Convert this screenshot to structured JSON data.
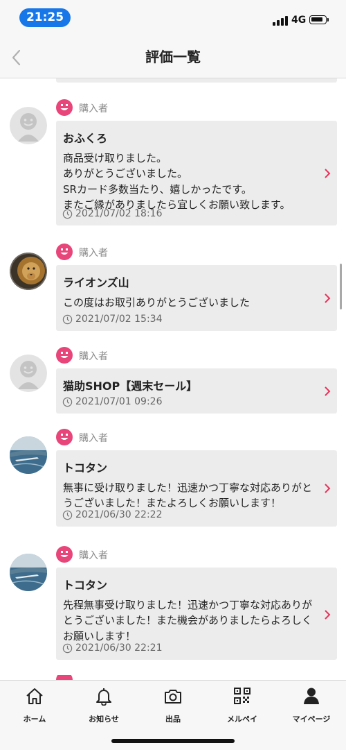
{
  "status_bar": {
    "time": "21:25",
    "network": "4G"
  },
  "header": {
    "title": "評価一覧"
  },
  "colors": {
    "accent_red": "#e8325a",
    "badge_pink": "#e8457a",
    "time_blue": "#1877e8",
    "card_bg": "#ececec"
  },
  "reviews": [
    {
      "role": "購入者",
      "name": "おふくろ",
      "comment": "商品受け取りました。\nありがとうございました。\nSRカード多数当たり、嬉しかったです。\nまたご縁がありましたら宜しくお願い致します。",
      "date": "2021/07/02 18:16",
      "avatar": "default-face"
    },
    {
      "role": "購入者",
      "name": "ライオンズ山",
      "comment": "この度はお取引ありがとうございました",
      "date": "2021/07/02 15:34",
      "avatar": "lion-photo"
    },
    {
      "role": "購入者",
      "name": "猫助SHOP【週末セール】",
      "comment": "",
      "date": "2021/07/01 09:26",
      "avatar": "default-face"
    },
    {
      "role": "購入者",
      "name": "トコタン",
      "comment": "無事に受け取りました！迅速かつ丁寧な対応ありがとうございました！またよろしくお願いします！",
      "date": "2021/06/30 22:22",
      "avatar": "sea-photo"
    },
    {
      "role": "購入者",
      "name": "トコタン",
      "comment": "先程無事受け取りました！迅速かつ丁寧な対応ありがとうございました！また機会がありましたらよろしくお願いします！",
      "date": "2021/06/30 22:21",
      "avatar": "sea-photo"
    }
  ],
  "tab_bar": {
    "items": [
      {
        "label": "ホーム",
        "icon": "home-icon"
      },
      {
        "label": "お知らせ",
        "icon": "bell-icon"
      },
      {
        "label": "出品",
        "icon": "camera-icon"
      },
      {
        "label": "メルペイ",
        "icon": "qr-code-icon"
      },
      {
        "label": "マイページ",
        "icon": "person-icon"
      }
    ]
  }
}
